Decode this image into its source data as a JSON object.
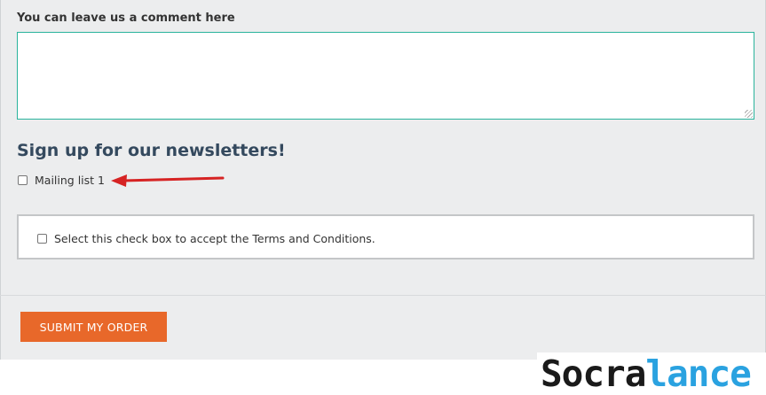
{
  "comment": {
    "label": "You can leave us a comment here",
    "value": ""
  },
  "newsletter": {
    "heading": "Sign up for our newsletters!",
    "mailing_list_label": "Mailing list 1",
    "mailing_list_checked": false
  },
  "terms": {
    "label": "Select this check box to accept the Terms and Conditions.",
    "checked": false
  },
  "submit": {
    "label": "SUBMIT MY ORDER"
  },
  "watermark": {
    "part1": "Socra",
    "part2": "lance"
  },
  "colors": {
    "accent_button": "#e8682a",
    "textarea_focus_border": "#2ab39c",
    "heading": "#34495e",
    "annotation_arrow": "#d62323",
    "watermark_blue": "#2aa2e0"
  },
  "icons": {
    "annotation": "red-arrow-pointing-left"
  }
}
